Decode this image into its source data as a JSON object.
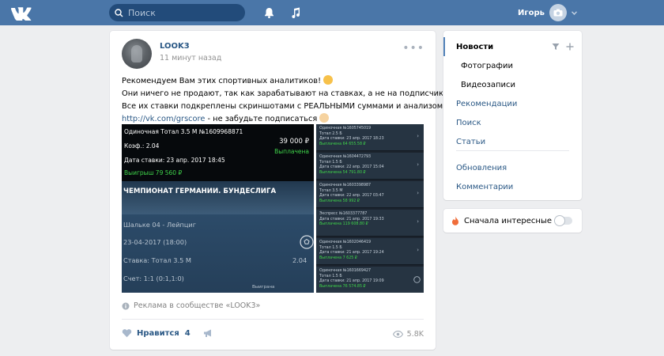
{
  "header": {
    "search_placeholder": "Поиск",
    "user_name": "Игорь"
  },
  "post": {
    "author": "LOOK3",
    "time": "11 минут назад",
    "lines": [
      "Рекомендуем Вам этих спортивных аналитиков!",
      "Они ничего не продают, так как зарабатывают на ставках, а не на подписчиках",
      "Все их ставки подкреплены скриншотами с РЕАЛЬНЫМИ суммами и анализом"
    ],
    "link": "http://vk.com/grscore",
    "link_suffix": " - не забудьте подписаться",
    "main_image": {
      "bet_title": "Одиночная Тотал 3.5 М №1609968871",
      "amount": "39 000 ₽",
      "status": "Выплачена",
      "coef": "Коэф.: 2.04",
      "date": "Дата ставки: 23 апр. 2017 18:45",
      "win": "Выигрыш 79 560 ₽",
      "league": "ЧЕМПИОНАТ ГЕРМАНИИ. БУНДЕСЛИГА",
      "match": "Шальке 04 - Лейпциг",
      "match_date": "23-04-2017 (18:00)",
      "stake": "Ставка: Тотал 3.5 М",
      "stake_coef": "2.04",
      "score": "Счет: 1:1 (0:1,1:0)",
      "result": "Выиграна"
    },
    "side_cards": [
      {
        "t1": "Одиночная №1605745019",
        "t2": "Тотал 2.5 Б",
        "t3": "Дата ставки: 23 апр. 2017 18:23",
        "t4": "Выплачена 64 655.58 ₽"
      },
      {
        "t1": "Одиночная №1604472793",
        "t2": "Тотал 1.5 Б",
        "t3": "Дата ставки: 22 апр. 2017 15:04",
        "t4": "Выплачена 54 791.80 ₽"
      },
      {
        "t1": "Одиночная №1603398987",
        "t2": "Тотал 3.5 М",
        "t3": "Дата ставки: 22 апр. 2017 03:47",
        "t4": "Выплачена 58 992 ₽"
      },
      {
        "t1": "Экспресс №1603377787",
        "t2": "",
        "t3": "Дата ставки: 21 апр. 2017 19:33",
        "t4": "Выплачена 119 608.80 ₽"
      },
      {
        "t1": "Одиночная №1602046419",
        "t2": "Тотал 1.5 Б",
        "t3": "Дата ставки: 21 апр. 2017 19:24",
        "t4": "Выплачена 7 625 ₽"
      },
      {
        "t1": "Одиночная №1601669427",
        "t2": "Тотал 1.5 Б",
        "t3": "Дата ставки: 21 апр. 2017 19:09",
        "t4": "Выплачена 76 574.85 ₽"
      }
    ],
    "ad_text": "Реклама в сообществе «LOOK3»",
    "like_label": "Нравится",
    "like_count": "4",
    "views": "5.8K"
  },
  "menu": {
    "items": [
      "Новости",
      "Фотографии",
      "Видеозаписи",
      "Рекомендации",
      "Поиск",
      "Статьи",
      "Обновления",
      "Комментарии"
    ]
  },
  "filter": {
    "label": "Сначала интересные"
  },
  "colors": {
    "header": "#4a76a8",
    "link": "#2a5885",
    "win_green": "#3fd44a"
  }
}
